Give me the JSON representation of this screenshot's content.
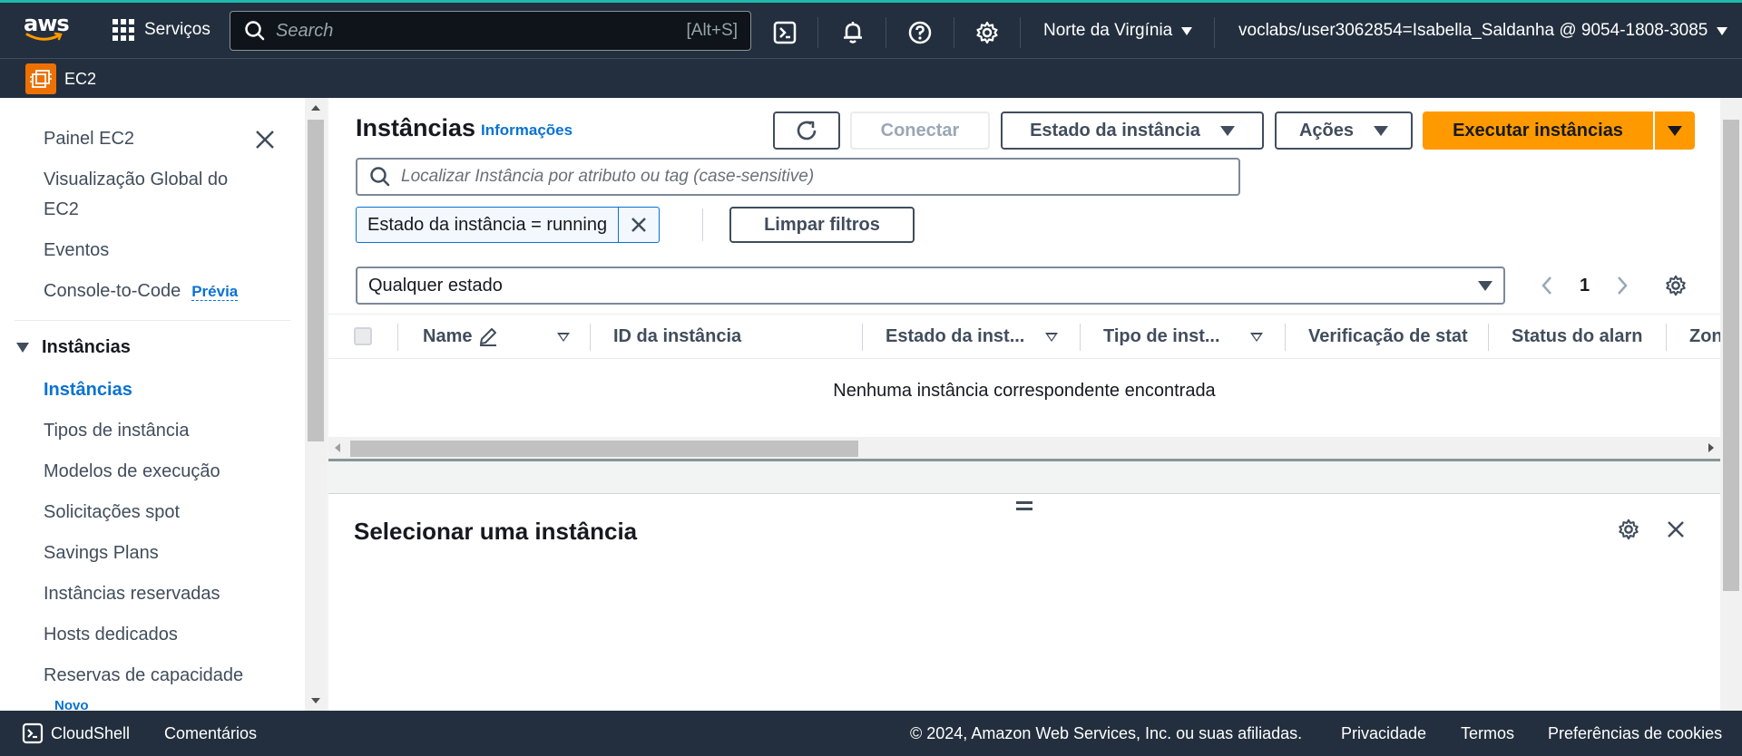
{
  "topnav": {
    "logo_text": "aws",
    "services_label": "Serviços",
    "search_placeholder": "Search",
    "search_shortcut": "[Alt+S]",
    "region": "Norte da Virgínia",
    "account": "voclabs/user3062854=Isabella_Saldanha @ 9054-1808-3085"
  },
  "subnav": {
    "service_name": "EC2"
  },
  "sidebar": {
    "items": [
      {
        "label": "Painel EC2"
      },
      {
        "label": "Visualização Global do"
      },
      {
        "label": "EC2"
      },
      {
        "label": "Eventos"
      },
      {
        "label": "Console-to-Code",
        "badge": "Prévia"
      }
    ],
    "section": "Instâncias",
    "section_items": [
      {
        "label": "Instâncias",
        "active": true
      },
      {
        "label": "Tipos de instância"
      },
      {
        "label": "Modelos de execução"
      },
      {
        "label": "Solicitações spot"
      },
      {
        "label": "Savings Plans"
      },
      {
        "label": "Instâncias reservadas"
      },
      {
        "label": "Hosts dedicados"
      },
      {
        "label": "Reservas de capacidade",
        "badge": "Novo"
      }
    ]
  },
  "main": {
    "title": "Instâncias",
    "info_link": "Informações",
    "buttons": {
      "connect": "Conectar",
      "instance_state": "Estado da instância",
      "actions": "Ações",
      "launch": "Executar instâncias"
    },
    "filter_placeholder": "Localizar Instância por atributo ou tag (case-sensitive)",
    "filter_token": "Estado da instância = running",
    "clear_filters": "Limpar filtros",
    "state_select": "Qualquer estado",
    "page_number": "1",
    "columns": [
      "Name",
      "ID da instância",
      "Estado da inst...",
      "Tipo de inst...",
      "Verificação de stat",
      "Status do alarn",
      "Zon"
    ],
    "empty_message": "Nenhuma instância correspondente encontrada",
    "split_title": "Selecionar uma instância"
  },
  "footer": {
    "cloudshell": "CloudShell",
    "feedback": "Comentários",
    "copyright": "© 2024, Amazon Web Services, Inc. ou suas afiliadas.",
    "privacy": "Privacidade",
    "terms": "Termos",
    "cookies": "Preferências de cookies"
  },
  "colors": {
    "nav_bg": "#232f3e",
    "link": "#0972d3",
    "primary": "#ff9900",
    "ec2_badge": "#ed7100"
  }
}
